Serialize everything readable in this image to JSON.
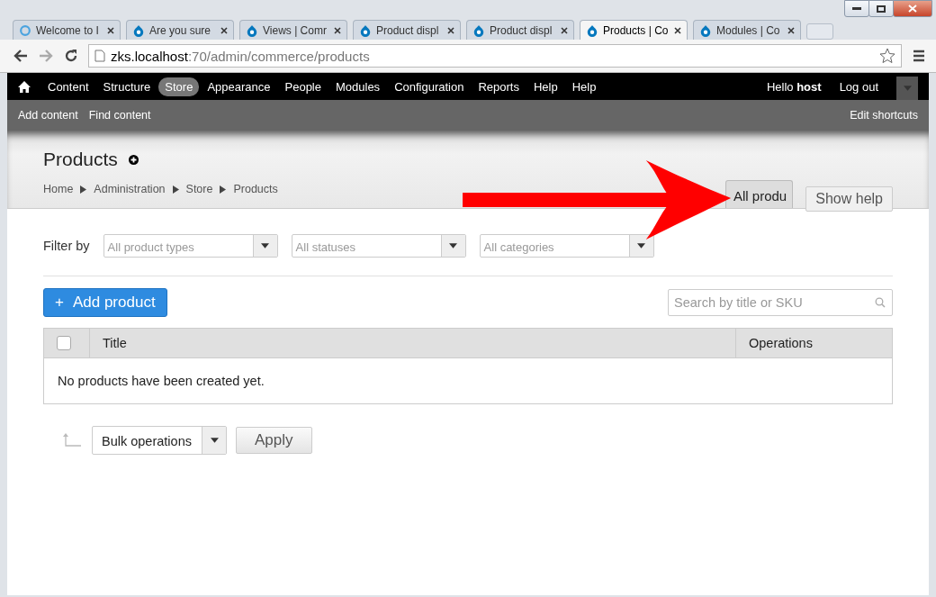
{
  "browser_tabs": [
    {
      "label": "Welcome to I",
      "kind": "ring",
      "selected": false
    },
    {
      "label": "Are you sure",
      "kind": "drop",
      "selected": false
    },
    {
      "label": "Views | Comr",
      "kind": "drop",
      "selected": false
    },
    {
      "label": "Product displ",
      "kind": "drop",
      "selected": false
    },
    {
      "label": "Product displ",
      "kind": "drop",
      "selected": false
    },
    {
      "label": "Products | Co",
      "kind": "drop",
      "selected": true
    },
    {
      "label": "Modules | Co",
      "kind": "drop",
      "selected": false
    }
  ],
  "address_bar": {
    "host": "zks.localhost",
    "path": ":70/admin/commerce/products"
  },
  "toolbar": {
    "items": [
      {
        "label": "Content",
        "selected": false
      },
      {
        "label": "Structure",
        "selected": false
      },
      {
        "label": "Store",
        "selected": true
      },
      {
        "label": "Appearance",
        "selected": false
      },
      {
        "label": "People",
        "selected": false
      },
      {
        "label": "Modules",
        "selected": false
      },
      {
        "label": "Configuration",
        "selected": false
      },
      {
        "label": "Reports",
        "selected": false
      },
      {
        "label": "Help",
        "selected": false
      },
      {
        "label": "Help",
        "selected": false
      }
    ],
    "greeting": "Hello **host**",
    "logout": "Log out"
  },
  "shortcuts": {
    "items": [
      "Add content",
      "Find content"
    ],
    "edit": "Edit shortcuts"
  },
  "page": {
    "title": "Products",
    "breadcrumb": [
      "Home",
      "Administration",
      "Store",
      "Products"
    ],
    "secondary_tabs": [
      {
        "label": "All produ",
        "selected": false
      }
    ],
    "help_button": "Show help"
  },
  "filters": {
    "label": "Filter by",
    "selects": [
      {
        "placeholder": "All product types"
      },
      {
        "placeholder": "All statuses"
      },
      {
        "placeholder": "All categories"
      }
    ]
  },
  "add_button": "Add product",
  "add_icon": "+",
  "search": {
    "placeholder": "Search by title or SKU"
  },
  "table": {
    "select_all_checked": false,
    "columns": [
      "Title",
      "Operations"
    ],
    "empty_message": "No products have been created yet."
  },
  "bulk": {
    "value": "Bulk operations",
    "apply": "Apply"
  }
}
